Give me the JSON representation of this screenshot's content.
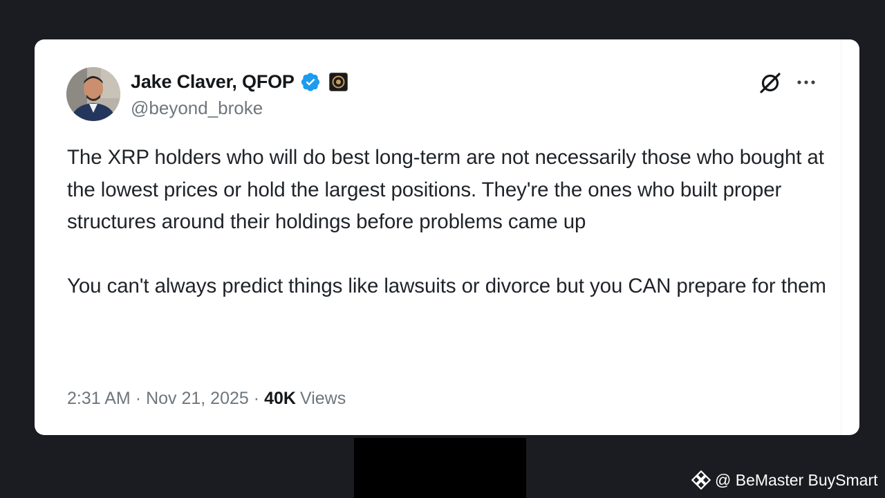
{
  "tweet": {
    "author": {
      "name": "Jake Claver, QFOP",
      "handle": "@beyond_broke",
      "verified": true,
      "avatar_icon": "profile-photo",
      "affiliate_icon": "affiliate-badge-icon"
    },
    "paragraphs": [
      "The XRP holders who will do best long-term are not necessarily those who bought at the lowest prices or hold the largest positions. They're the ones who built proper structures around their holdings before problems came up",
      "You can't always predict things like lawsuits or divorce but you CAN prepare for them"
    ],
    "meta": {
      "time": "2:31 AM",
      "separator": "·",
      "date": "Nov 21, 2025",
      "views_count": "40K",
      "views_label": "Views"
    },
    "actions": {
      "grok_icon": "grok-icon",
      "more_icon": "more-icon"
    }
  },
  "watermark": {
    "text": "@ BeMaster BuySmart",
    "icon": "binance-logo-icon"
  },
  "colors": {
    "background": "#1b1c21",
    "card": "#ffffff",
    "text_primary": "#14171a",
    "text_secondary": "#6e767d",
    "verified_blue": "#1d9bf0"
  }
}
